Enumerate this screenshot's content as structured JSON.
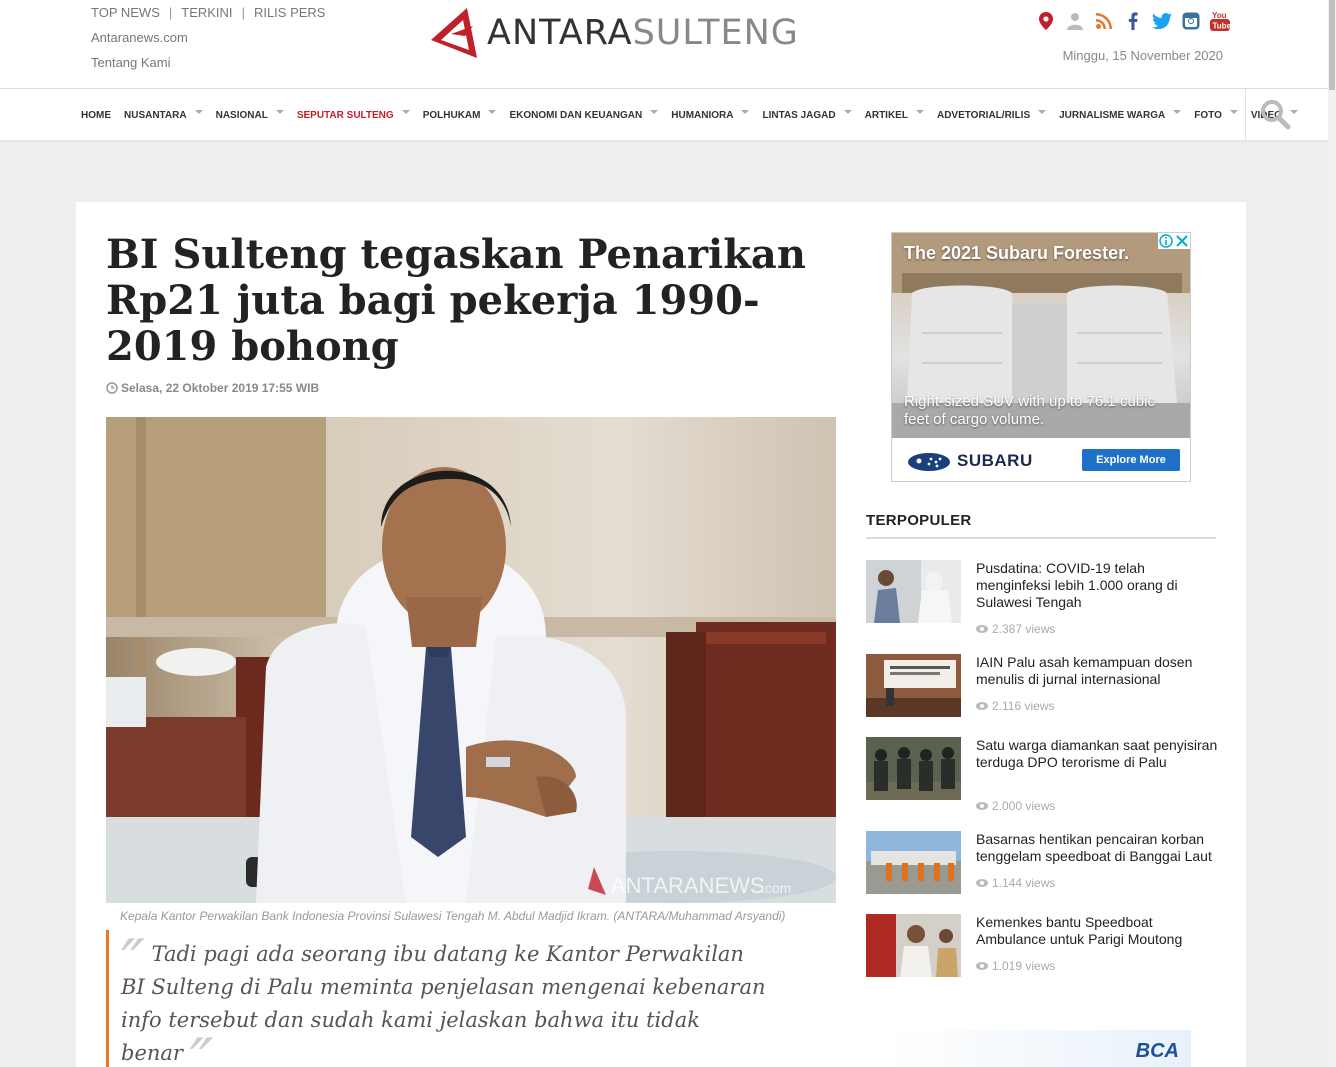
{
  "header": {
    "top_links": [
      "TOP NEWS",
      "TERKINI",
      "RILIS PERS"
    ],
    "link_antaranews": "Antaranews.com",
    "link_about": "Tentang Kami",
    "logo_part1": "ANTARA",
    "logo_part2": "SULTENG",
    "date": "Minggu, 15 November 2020",
    "social_icons": [
      "location-pin-icon",
      "user-icon",
      "rss-icon",
      "facebook-icon",
      "twitter-icon",
      "instagram-icon",
      "youtube-icon"
    ],
    "colors": {
      "brand_red": "#c0202a",
      "active_nav": "#c0202a"
    }
  },
  "nav": {
    "items": [
      {
        "label": "HOME",
        "caret": false
      },
      {
        "label": "NUSANTARA",
        "caret": true
      },
      {
        "label": "NASIONAL",
        "caret": true
      },
      {
        "label": "SEPUTAR SULTENG",
        "caret": true,
        "active": true
      },
      {
        "label": "POLHUKAM",
        "caret": true
      },
      {
        "label": "EKONOMI DAN KEUANGAN",
        "caret": true
      },
      {
        "label": "HUMANIORA",
        "caret": true
      },
      {
        "label": "LINTAS JAGAD",
        "caret": true
      },
      {
        "label": "ARTIKEL",
        "caret": true
      },
      {
        "label": "ADVETORIAL/RILIS",
        "caret": true
      },
      {
        "label": "JURNALISME WARGA",
        "caret": true
      },
      {
        "label": "FOTO",
        "caret": true
      },
      {
        "label": "VIDEO",
        "caret": true
      }
    ]
  },
  "article": {
    "title": "BI Sulteng tegaskan Penarikan Rp21 juta bagi pekerja 1990-2019 bohong",
    "datetime": "Selasa, 22 Oktober 2019 17:55 WIB",
    "photo_watermark": "ANTARANEWS",
    "photo_watermark_sub": ".com",
    "caption": "Kepala Kantor Perwakilan Bank Indonesia Provinsi Sulawesi Tengah M. Abdul Madjid Ikram. (ANTARA/Muhammad Arsyandi)",
    "quote": "Tadi pagi ada seorang ibu datang ke Kantor Perwakilan BI Sulteng di Palu meminta penjelasan mengenai kebenaran info tersebut dan sudah kami jelaskan bahwa itu tidak benar",
    "quote_accent": "#e07a2c"
  },
  "ad": {
    "headline": "The 2021 Subaru Forester.",
    "sub": "Right-sized SUV with up to 76.1 cubic feet of cargo volume.",
    "brand": "SUBARU",
    "cta": "Explore More"
  },
  "popular": {
    "heading": "TERPOPULER",
    "items": [
      {
        "title": "Pusdatina: COVID-19 telah menginfeksi lebih 1.000 orang di Sulawesi Tengah",
        "views": "2.387 views"
      },
      {
        "title": "IAIN Palu asah kemampuan dosen menulis di jurnal internasional",
        "views": "2.116 views"
      },
      {
        "title": "Satu warga diamankan saat penyisiran terduga DPO terorisme di Palu",
        "views": "2.000 views"
      },
      {
        "title": "Basarnas hentikan pencairan korban tenggelam speedboat di Banggai Laut",
        "views": "1.144 views"
      },
      {
        "title": "Kemenkes bantu Speedboat Ambulance untuk Parigi Moutong",
        "views": "1.019 views"
      }
    ]
  },
  "bottom_ad": {
    "brand": "BCA"
  }
}
